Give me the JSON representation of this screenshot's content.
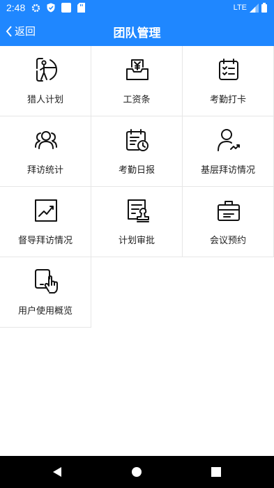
{
  "status_bar": {
    "time": "2:48",
    "network": "LTE",
    "accent": "#1f87ff"
  },
  "header": {
    "back_label": "返回",
    "title": "团队管理"
  },
  "grid": {
    "items": [
      {
        "label": "猎人计划",
        "icon": "archer-icon"
      },
      {
        "label": "工资条",
        "icon": "salary-inbox-icon"
      },
      {
        "label": "考勤打卡",
        "icon": "calendar-check-icon"
      },
      {
        "label": "拜访统计",
        "icon": "team-icon"
      },
      {
        "label": "考勤日报",
        "icon": "calendar-clock-icon"
      },
      {
        "label": "基层拜访情况",
        "icon": "user-trend-icon"
      },
      {
        "label": "督导拜访情况",
        "icon": "chart-line-icon"
      },
      {
        "label": "计划审批",
        "icon": "document-stamp-icon"
      },
      {
        "label": "会议预约",
        "icon": "briefcase-icon"
      },
      {
        "label": "用户使用概览",
        "icon": "phone-touch-icon"
      }
    ]
  }
}
